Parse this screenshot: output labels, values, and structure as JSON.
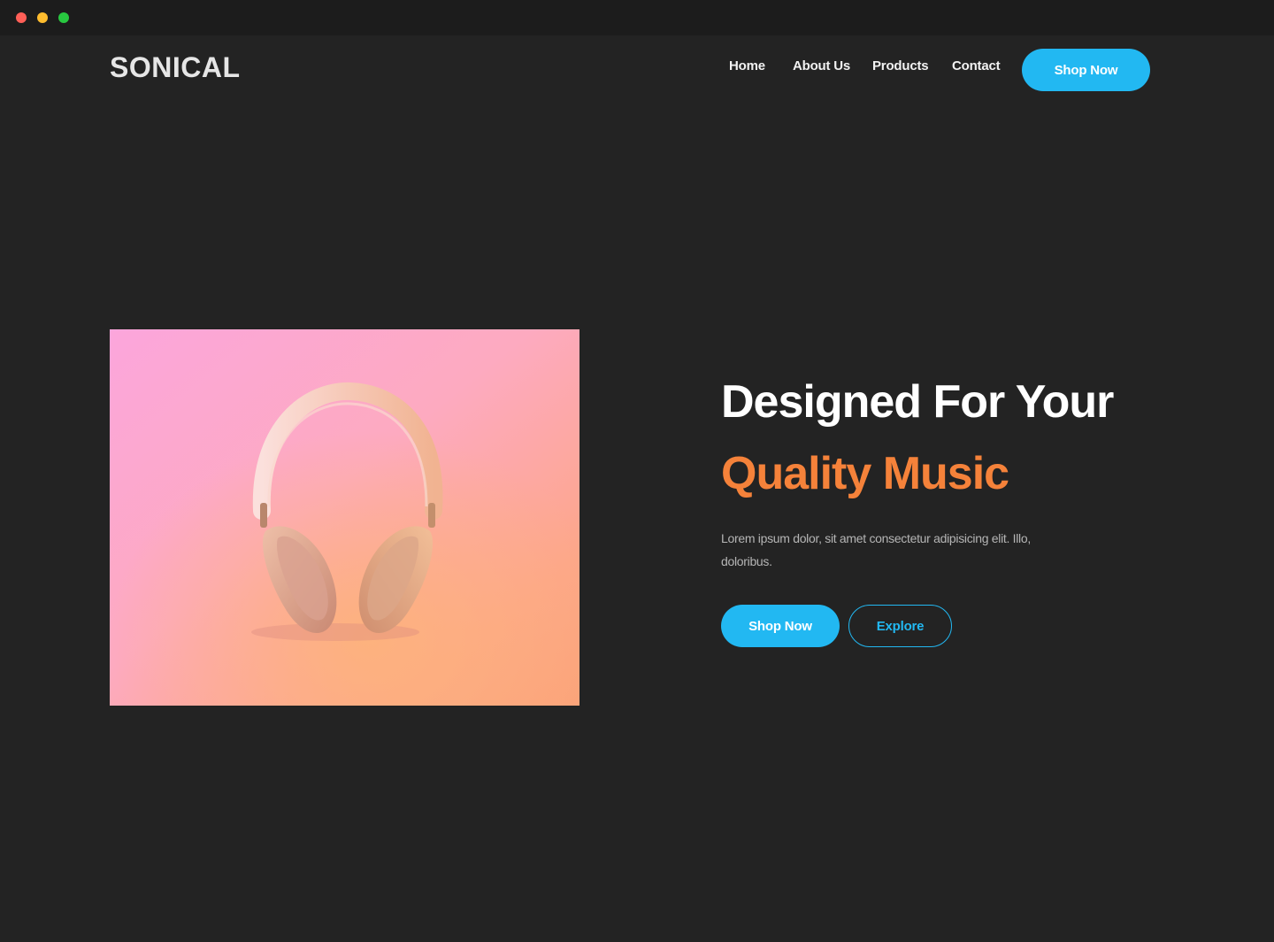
{
  "window": {
    "controls": [
      "close",
      "minimize",
      "maximize"
    ]
  },
  "colors": {
    "background": "#232323",
    "titlebar": "#1c1c1c",
    "accent_blue": "#22b8f2",
    "accent_orange": "#f5823a",
    "close_dot": "#ff5f57",
    "minimize_dot": "#febc2e",
    "maximize_dot": "#28c840"
  },
  "header": {
    "brand": "SONICAL",
    "nav": [
      "Home",
      "About Us",
      "Products",
      "Contact"
    ],
    "cta_label": "Shop Now"
  },
  "hero": {
    "image_subject": "headphones-image",
    "headline_line1": "Designed For Your",
    "headline_line2": "Quality Music",
    "description": "Lorem ipsum dolor, sit amet consectetur adipisicing elit. Illo, doloribus.",
    "primary_button": "Shop Now",
    "secondary_button": "Explore"
  }
}
